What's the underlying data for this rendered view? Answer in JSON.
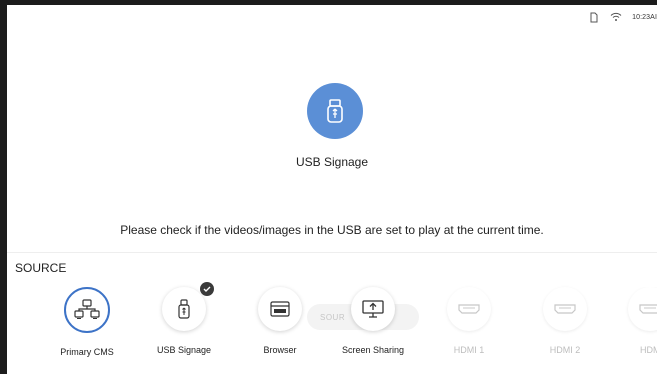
{
  "status_bar": {
    "time": "10:23AI",
    "icons": [
      "sd-card-icon",
      "wifi-icon"
    ]
  },
  "hero": {
    "icon": "usb-drive-icon",
    "title": "USB Signage",
    "accent": "#5b8fd6"
  },
  "message": "Please check if the videos/images in the USB are set to play at the current time.",
  "source_section": {
    "heading": "SOURCE",
    "watermark": "SOUR"
  },
  "sources": [
    {
      "label": "Primary CMS",
      "icon": "cms-network-icon",
      "selected": true,
      "enabled": true
    },
    {
      "label": "USB Signage",
      "icon": "usb-drive-icon",
      "checked": true,
      "enabled": true
    },
    {
      "label": "Browser",
      "icon": "browser-icon",
      "enabled": true
    },
    {
      "label": "Screen Sharing",
      "icon": "screen-share-icon",
      "enabled": true
    },
    {
      "label": "HDMI 1",
      "icon": "hdmi-port-icon",
      "enabled": false
    },
    {
      "label": "HDMI 2",
      "icon": "hdmi-port-icon",
      "enabled": false
    },
    {
      "label": "HDM",
      "icon": "hdmi-port-icon",
      "enabled": false
    }
  ],
  "colors": {
    "selected_ring": "#3d73c7",
    "disabled_text": "#bdbdbd"
  }
}
